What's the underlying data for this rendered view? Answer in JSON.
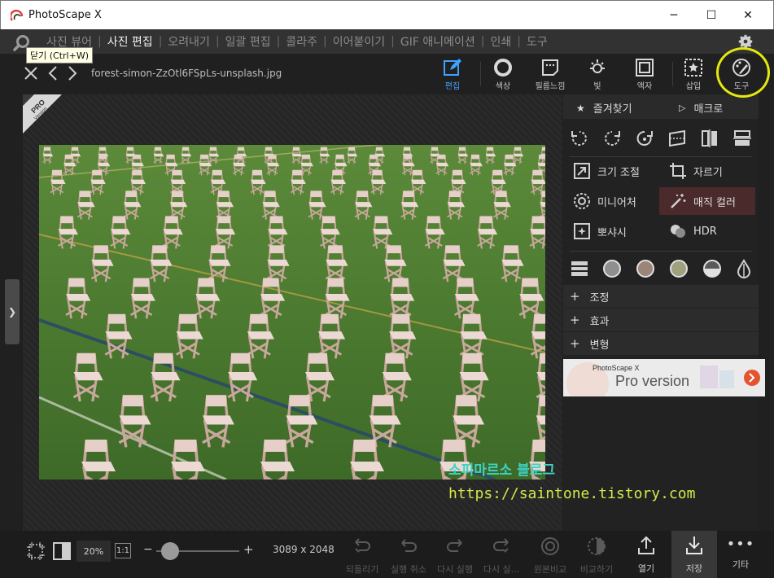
{
  "app": {
    "title": "PhotoScape X"
  },
  "window_controls": {
    "minimize": "─",
    "maximize": "☐",
    "close": "✕"
  },
  "menu": {
    "items": [
      "사진 뷰어",
      "사진 편집",
      "오려내기",
      "일괄 편집",
      "콜라주",
      "이어붙이기",
      "GIF 애니메이션",
      "인쇄",
      "도구"
    ],
    "active_index": 1
  },
  "tooltip": "닫기 (Ctrl+W)",
  "file": {
    "name": "forest-simon-ZzOtl6FSpLs-unsplash.jpg"
  },
  "tools": [
    {
      "label": "편집",
      "icon": "edit-icon",
      "active": true
    },
    {
      "label": "색상",
      "icon": "color-circle-icon",
      "active": false
    },
    {
      "label": "필름느낌",
      "icon": "film-icon",
      "active": false
    },
    {
      "label": "빛",
      "icon": "light-icon",
      "active": false
    },
    {
      "label": "액자",
      "icon": "frame-icon",
      "active": false
    },
    {
      "label": "삽입",
      "icon": "insert-icon",
      "active": false
    },
    {
      "label": "도구",
      "icon": "palette-tools-icon",
      "active": false
    }
  ],
  "panel": {
    "favorites": "즐겨찾기",
    "macro": "매크로",
    "effects": [
      {
        "label": "크기 조절",
        "icon": "resize-icon"
      },
      {
        "label": "자르기",
        "icon": "crop-icon"
      },
      {
        "label": "미니어처",
        "icon": "miniature-icon"
      },
      {
        "label": "매직 컬러",
        "icon": "magic-color-icon"
      },
      {
        "label": "뽀샤시",
        "icon": "bloom-icon"
      },
      {
        "label": "HDR",
        "icon": "hdr-icon"
      }
    ],
    "accordions": [
      "조정",
      "효과",
      "변형"
    ],
    "banner": {
      "brand": "PhotoScape X",
      "text": "Pro version"
    }
  },
  "pro_badge": {
    "line1": "PRO",
    "line2": "Version"
  },
  "watermark": {
    "line1": "소피마르소 블로그",
    "line2": "https://saintone.tistory.com"
  },
  "status": {
    "zoom": "20%",
    "one_to_one": "1:1",
    "dimensions": "3089 x 2048",
    "actions": [
      {
        "label": "되돌리기",
        "enabled": false
      },
      {
        "label": "실행 취소",
        "enabled": false
      },
      {
        "label": "다시 실행",
        "enabled": false
      },
      {
        "label": "다시 실...",
        "enabled": false
      },
      {
        "label": "원본비교",
        "enabled": false
      },
      {
        "label": "비교하기",
        "enabled": false
      },
      {
        "label": "열기",
        "enabled": true
      },
      {
        "label": "저장",
        "enabled": true
      },
      {
        "label": "기타",
        "enabled": true
      }
    ]
  },
  "colors": {
    "accent": "#3fa2ff",
    "highlight": "#e5e80e",
    "grass": "#4f7a34"
  }
}
